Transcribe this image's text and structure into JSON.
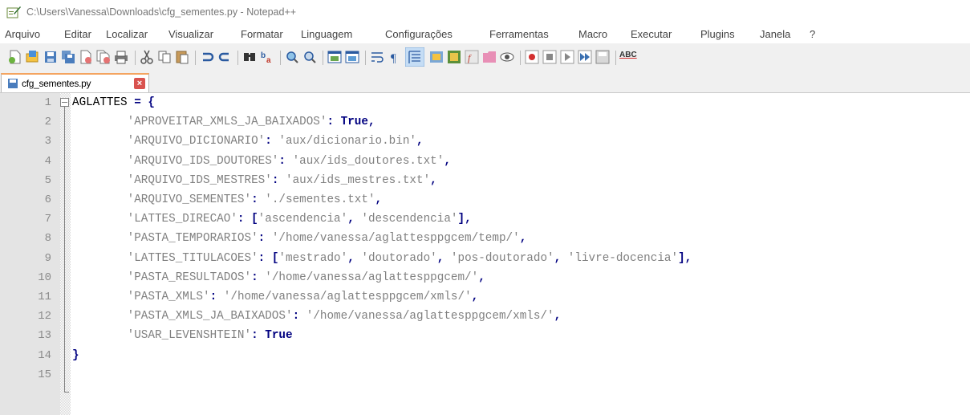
{
  "window": {
    "title": "C:\\Users\\Vanessa\\Downloads\\cfg_sementes.py - Notepad++"
  },
  "menu": [
    "Arquivo",
    "Editar",
    "Localizar",
    "Visualizar",
    "Formatar",
    "Linguagem",
    "Configurações",
    "Ferramentas",
    "Macro",
    "Executar",
    "Plugins",
    "Janela",
    "?"
  ],
  "toolbar": {
    "buttons": [
      "new-file-icon",
      "open-file-icon",
      "save-icon",
      "save-all-icon",
      "close-icon",
      "close-all-icon",
      "print-icon",
      "cut-icon",
      "copy-icon",
      "paste-icon",
      "undo-icon",
      "redo-icon",
      "find-icon",
      "replace-icon",
      "zoom-in-icon",
      "zoom-out-icon",
      "sync-vertical-icon",
      "sync-horizontal-icon",
      "word-wrap-icon",
      "show-all-chars-icon",
      "indent-guide-icon",
      "user-language-icon",
      "document-map-icon",
      "function-list-icon",
      "folder-workspace-icon",
      "monitoring-icon",
      "record-macro-icon",
      "stop-record-icon",
      "play-macro-icon",
      "run-macro-multiple-icon",
      "save-macro-icon",
      "spell-check-icon"
    ],
    "spell_label": "ABC"
  },
  "tab": {
    "label": "cfg_sementes.py"
  },
  "editor": {
    "line_numbers": [
      "1",
      "2",
      "3",
      "4",
      "5",
      "6",
      "7",
      "8",
      "9",
      "10",
      "11",
      "12",
      "13",
      "14",
      "15"
    ],
    "lines": [
      [
        {
          "t": "AGLATTES ",
          "c": "k"
        },
        {
          "t": "= {",
          "c": "o"
        }
      ],
      [
        {
          "t": "        ",
          "c": "k"
        },
        {
          "t": "'APROVEITAR_XMLS_JA_BAIXADOS'",
          "c": "s"
        },
        {
          "t": ": ",
          "c": "o"
        },
        {
          "t": "True",
          "c": "b"
        },
        {
          "t": ",",
          "c": "o"
        }
      ],
      [
        {
          "t": "        ",
          "c": "k"
        },
        {
          "t": "'ARQUIVO_DICIONARIO'",
          "c": "s"
        },
        {
          "t": ": ",
          "c": "o"
        },
        {
          "t": "'aux/dicionario.bin'",
          "c": "s"
        },
        {
          "t": ",",
          "c": "o"
        }
      ],
      [
        {
          "t": "        ",
          "c": "k"
        },
        {
          "t": "'ARQUIVO_IDS_DOUTORES'",
          "c": "s"
        },
        {
          "t": ": ",
          "c": "o"
        },
        {
          "t": "'aux/ids_doutores.txt'",
          "c": "s"
        },
        {
          "t": ",",
          "c": "o"
        }
      ],
      [
        {
          "t": "        ",
          "c": "k"
        },
        {
          "t": "'ARQUIVO_IDS_MESTRES'",
          "c": "s"
        },
        {
          "t": ": ",
          "c": "o"
        },
        {
          "t": "'aux/ids_mestres.txt'",
          "c": "s"
        },
        {
          "t": ",",
          "c": "o"
        }
      ],
      [
        {
          "t": "        ",
          "c": "k"
        },
        {
          "t": "'ARQUIVO_SEMENTES'",
          "c": "s"
        },
        {
          "t": ": ",
          "c": "o"
        },
        {
          "t": "'./sementes.txt'",
          "c": "s"
        },
        {
          "t": ",",
          "c": "o"
        }
      ],
      [
        {
          "t": "        ",
          "c": "k"
        },
        {
          "t": "'LATTES_DIRECAO'",
          "c": "s"
        },
        {
          "t": ": [",
          "c": "o"
        },
        {
          "t": "'ascendencia'",
          "c": "s"
        },
        {
          "t": ", ",
          "c": "o"
        },
        {
          "t": "'descendencia'",
          "c": "s"
        },
        {
          "t": "],",
          "c": "o"
        }
      ],
      [
        {
          "t": "        ",
          "c": "k"
        },
        {
          "t": "'PASTA_TEMPORARIOS'",
          "c": "s"
        },
        {
          "t": ": ",
          "c": "o"
        },
        {
          "t": "'/home/vanessa/aglattesppgcem/temp/'",
          "c": "s"
        },
        {
          "t": ",",
          "c": "o"
        }
      ],
      [
        {
          "t": "        ",
          "c": "k"
        },
        {
          "t": "'LATTES_TITULACOES'",
          "c": "s"
        },
        {
          "t": ": [",
          "c": "o"
        },
        {
          "t": "'mestrado'",
          "c": "s"
        },
        {
          "t": ", ",
          "c": "o"
        },
        {
          "t": "'doutorado'",
          "c": "s"
        },
        {
          "t": ", ",
          "c": "o"
        },
        {
          "t": "'pos-doutorado'",
          "c": "s"
        },
        {
          "t": ", ",
          "c": "o"
        },
        {
          "t": "'livre-docencia'",
          "c": "s"
        },
        {
          "t": "],",
          "c": "o"
        }
      ],
      [
        {
          "t": "        ",
          "c": "k"
        },
        {
          "t": "'PASTA_RESULTADOS'",
          "c": "s"
        },
        {
          "t": ": ",
          "c": "o"
        },
        {
          "t": "'/home/vanessa/aglattesppgcem/'",
          "c": "s"
        },
        {
          "t": ",",
          "c": "o"
        }
      ],
      [
        {
          "t": "        ",
          "c": "k"
        },
        {
          "t": "'PASTA_XMLS'",
          "c": "s"
        },
        {
          "t": ": ",
          "c": "o"
        },
        {
          "t": "'/home/vanessa/aglattesppgcem/xmls/'",
          "c": "s"
        },
        {
          "t": ",",
          "c": "o"
        }
      ],
      [
        {
          "t": "        ",
          "c": "k"
        },
        {
          "t": "'PASTA_XMLS_JA_BAIXADOS'",
          "c": "s"
        },
        {
          "t": ": ",
          "c": "o"
        },
        {
          "t": "'/home/vanessa/aglattesppgcem/xmls/'",
          "c": "s"
        },
        {
          "t": ",",
          "c": "o"
        }
      ],
      [
        {
          "t": "        ",
          "c": "k"
        },
        {
          "t": "'USAR_LEVENSHTEIN'",
          "c": "s"
        },
        {
          "t": ": ",
          "c": "o"
        },
        {
          "t": "True",
          "c": "b"
        }
      ],
      [
        {
          "t": "}",
          "c": "o"
        }
      ],
      []
    ]
  }
}
